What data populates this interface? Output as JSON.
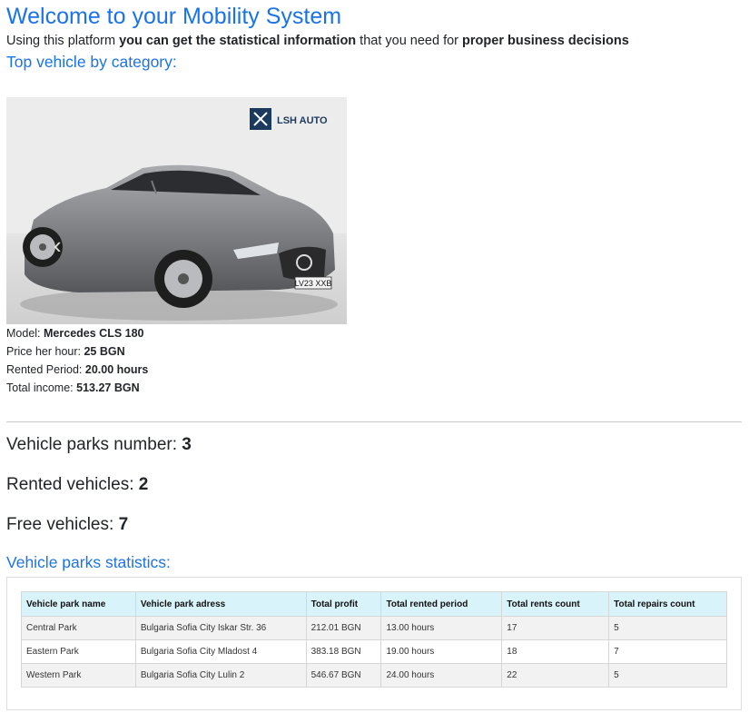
{
  "header": {
    "title": "Welcome to your Mobility System",
    "intro_prefix": "Using this platform ",
    "intro_bold1": "you can get the statistical information",
    "intro_mid": " that you need for ",
    "intro_bold2": "proper business decisions"
  },
  "top_vehicle": {
    "heading": "Top vehicle by category:",
    "image": {
      "icon": "car-photo",
      "logo_text": "LSH AUTO",
      "plate_text": "LV23 XXB"
    },
    "model_label": "Model:",
    "model_value": "Mercedes CLS 180",
    "price_label": "Price her hour:",
    "price_value": "25 BGN",
    "period_label": "Rented Period:",
    "period_value": "20.00 hours",
    "income_label": "Total income:",
    "income_value": "513.27 BGN"
  },
  "stats": {
    "parks_label": "Vehicle parks number:",
    "parks_value": "3",
    "rented_label": "Rented vehicles:",
    "rented_value": "2",
    "free_label": "Free vehicles:",
    "free_value": "7"
  },
  "parks_table": {
    "heading": "Vehicle parks statistics:",
    "columns": [
      "Vehicle park name",
      "Vehicle park adress",
      "Total profit",
      "Total rented period",
      "Total rents count",
      "Total repairs count"
    ],
    "rows": [
      [
        "Central Park",
        "Bulgaria Sofia City Iskar Str. 36",
        "212.01 BGN",
        "13.00 hours",
        "17",
        "5"
      ],
      [
        "Eastern Park",
        "Bulgaria Sofia City Mladost 4",
        "383.18 BGN",
        "19.00 hours",
        "18",
        "7"
      ],
      [
        "Western Park",
        "Bulgaria Sofia City Lulin 2",
        "546.67 BGN",
        "24.00 hours",
        "22",
        "5"
      ]
    ]
  },
  "colors": {
    "accent": "#1a73e8",
    "table_header": "#d9f3fa"
  }
}
